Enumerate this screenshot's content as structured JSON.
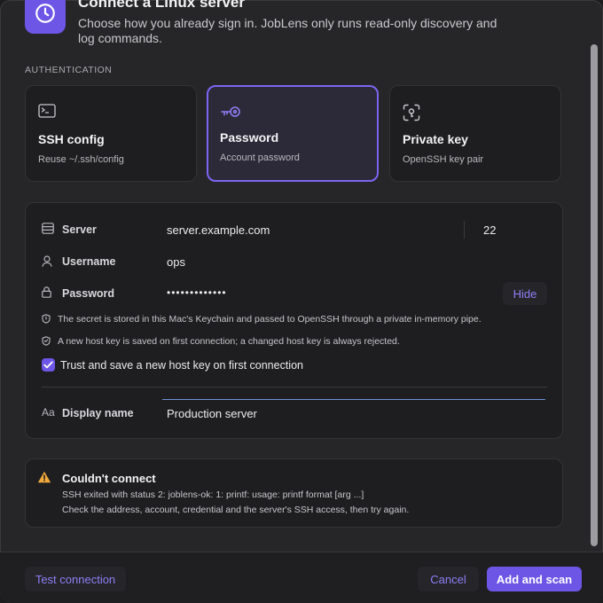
{
  "header": {
    "title": "Connect a Linux server",
    "subtitle": "Choose how you already sign in. JobLens only runs read-only discovery and log commands.",
    "icon": "clock-icon"
  },
  "auth": {
    "section_label": "AUTHENTICATION",
    "options": [
      {
        "title": "SSH config",
        "desc": "Reuse ~/.ssh/config",
        "icon": "terminal-icon",
        "selected": false
      },
      {
        "title": "Password",
        "desc": "Account password",
        "icon": "key-icon",
        "selected": true
      },
      {
        "title": "Private key",
        "desc": "OpenSSH key pair",
        "icon": "face-scan-icon",
        "selected": false
      }
    ]
  },
  "form": {
    "server": {
      "label": "Server",
      "value": "server.example.com",
      "port": "22"
    },
    "username": {
      "label": "Username",
      "value": "ops"
    },
    "password": {
      "label": "Password",
      "value": "•••••••••••••",
      "hide_label": "Hide"
    },
    "notes": [
      "The secret is stored in this Mac's Keychain and passed to OpenSSH through a private in-memory pipe.",
      "A new host key is saved on first connection; a changed host key is always rejected."
    ],
    "trust": {
      "label": "Trust and save a new host key on first connection",
      "checked": true
    },
    "display_name": {
      "label": "Display name",
      "icon_text": "Aa",
      "value": "Production server"
    }
  },
  "error": {
    "title": "Couldn't connect",
    "line1": "SSH exited with status 2: joblens-ok: 1: printf: usage: printf format [arg ...]",
    "line2": "Check the address, account, credential and the server's SSH access, then try again."
  },
  "footer": {
    "test_label": "Test connection",
    "cancel_label": "Cancel",
    "add_label": "Add and scan"
  },
  "colors": {
    "accent": "#6d55e6",
    "accent_text": "#8f7ef5",
    "warning": "#f0a93a",
    "background": "#262628"
  }
}
